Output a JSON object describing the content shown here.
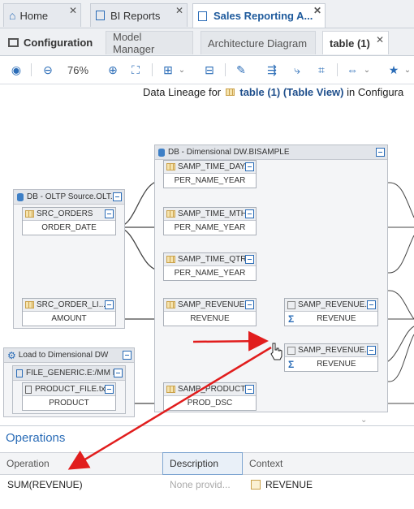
{
  "top_tabs": [
    {
      "label": "Home"
    },
    {
      "label": "BI Reports"
    },
    {
      "label": "Sales Reporting A..."
    }
  ],
  "sub_tabs": [
    {
      "label": "Configuration"
    },
    {
      "label": "Model Manager"
    },
    {
      "label": "Architecture Diagram"
    },
    {
      "label": "table (1)"
    }
  ],
  "toolbar": {
    "zoom": "76%"
  },
  "lineage": {
    "prefix": "Data Lineage for",
    "table": "table (1)",
    "view": "(Table View)",
    "suffix": "in Configura"
  },
  "diagram": {
    "oltp_group": "DB - OLTP Source.OLT...",
    "dw_group": "DB - Dimensional DW.BISAMPLE",
    "load_group": "Load to Dimensional DW",
    "file_group": "FILE_GENERIC.E:/MM I...",
    "tables": {
      "src_orders": {
        "name": "SRC_ORDERS",
        "col": "ORDER_DATE"
      },
      "src_order_li": {
        "name": "SRC_ORDER_LI...",
        "col": "AMOUNT"
      },
      "product_file": {
        "name": "PRODUCT_FILE.txt",
        "col": "PRODUCT"
      },
      "time_day": {
        "name": "SAMP_TIME_DAY...",
        "col": "PER_NAME_YEAR"
      },
      "time_mth": {
        "name": "SAMP_TIME_MTH...",
        "col": "PER_NAME_YEAR"
      },
      "time_qtr": {
        "name": "SAMP_TIME_QTR...",
        "col": "PER_NAME_YEAR"
      },
      "revenue": {
        "name": "SAMP_REVENUE...",
        "col": "REVENUE"
      },
      "product": {
        "name": "SAMP_PRODUCT...",
        "col": "PROD_DSC"
      },
      "rev_a": {
        "name": "SAMP_REVENUE...",
        "col": "REVENUE"
      },
      "rev_b": {
        "name": "SAMP_REVENUE...",
        "col": "REVENUE"
      }
    }
  },
  "operations": {
    "title": "Operations",
    "columns": [
      "Operation",
      "Description",
      "Context"
    ],
    "row": {
      "operation": "SUM(REVENUE)",
      "description": "None provid...",
      "context": "REVENUE"
    }
  }
}
